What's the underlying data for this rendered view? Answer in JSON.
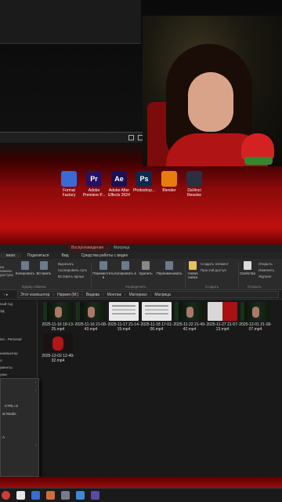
{
  "desktop_apps": [
    {
      "label": "Format Factory",
      "icon": "format-factory-icon",
      "color": "#3a6ad4",
      "glyph": ""
    },
    {
      "label": "Adobe Premiere P...",
      "icon": "premiere-icon",
      "color": "#2a1060",
      "glyph": "Pr"
    },
    {
      "label": "Adobe After Effects 2024",
      "icon": "after-effects-icon",
      "color": "#1c1050",
      "glyph": "Ae"
    },
    {
      "label": "Photoshop...",
      "icon": "photoshop-icon",
      "color": "#0a2a50",
      "glyph": "Ps"
    },
    {
      "label": "Blender",
      "icon": "blender-icon",
      "color": "#e87d0d",
      "glyph": ""
    },
    {
      "label": "DaVinci Resolve",
      "icon": "davinci-icon",
      "color": "#2a3040",
      "glyph": ""
    }
  ],
  "explorer": {
    "context_tab": "Воспроизведение",
    "window_title": "Матрица",
    "ribbon_tabs": [
      "вная",
      "Поделиться",
      "Вид",
      "Средства работы с видео"
    ],
    "ribbon": {
      "pin": "на панели доступа",
      "copy": "Копировать",
      "paste": "Вставить",
      "cut": "Вырезать",
      "copy_path": "Скопировать путь",
      "paste_shortcut": "Вставить ярлык",
      "move_to": "Переместить в",
      "copy_to": "Копировать в",
      "delete": "Удалить",
      "rename": "Переименовать",
      "new_folder": "Новая папка",
      "new_item": "Создать элемент",
      "easy_access": "Простой доступ",
      "properties": "Свойства",
      "open": "Открыть",
      "edit": "Изменить",
      "journal": "Журнал",
      "group_clipboard": "Буфер обмена",
      "group_organize": "Упорядочить",
      "group_create": "Создать",
      "group_open": "Открыть"
    },
    "breadcrumb": [
      "Этот компьютер",
      "Наркия (M:)",
      "Видева",
      "Монтаж",
      "Материал",
      "Матрица"
    ],
    "sidebar_items": [
      "ный год",
      "3Д",
      "",
      "",
      "",
      "ive - Personal",
      "",
      "компьютер",
      "о",
      "ументы",
      "узки",
      "",
      "ражения"
    ],
    "files": [
      {
        "name": "2025-11-16 18-13-25.mp4",
        "thumb": "dark"
      },
      {
        "name": "2025-11-16 21-08-43.mp4",
        "thumb": "dark"
      },
      {
        "name": "2025-11-17 21-14-19.mp4",
        "thumb": "white"
      },
      {
        "name": "2025-11-18 17-01-06.mp4",
        "thumb": "white"
      },
      {
        "name": "2025-11-22 21-49-42.mp4",
        "thumb": "dark"
      },
      {
        "name": "2025-11-27 21-57-13.mp4",
        "thumb": "red"
      },
      {
        "name": "2025-12-01 21-18-07.mp4",
        "thumb": "dark"
      },
      {
        "name": "2025-12-02 12-49-32.mp4",
        "thumb": "redface"
      }
    ]
  },
  "context_menu": [
    {
      "label": "",
      "hotkey": "",
      "chevron": true
    },
    {
      "label": "",
      "hotkey": "",
      "chevron": true
    },
    {
      "label": "",
      "hotkey": "",
      "chevron": false
    },
    {
      "label": "",
      "hotkey": "CTRL+Z",
      "chevron": false
    },
    {
      "label": "al Studio",
      "hotkey": "",
      "chevron": false
    },
    {
      "label": "",
      "hotkey": "",
      "chevron": false
    },
    {
      "label": "",
      "hotkey": "",
      "chevron": false
    },
    {
      "label": "A",
      "hotkey": "",
      "chevron": false
    },
    {
      "label": "",
      "hotkey": "",
      "chevron": true
    },
    {
      "label": "",
      "hotkey": "",
      "chevron": false
    }
  ]
}
